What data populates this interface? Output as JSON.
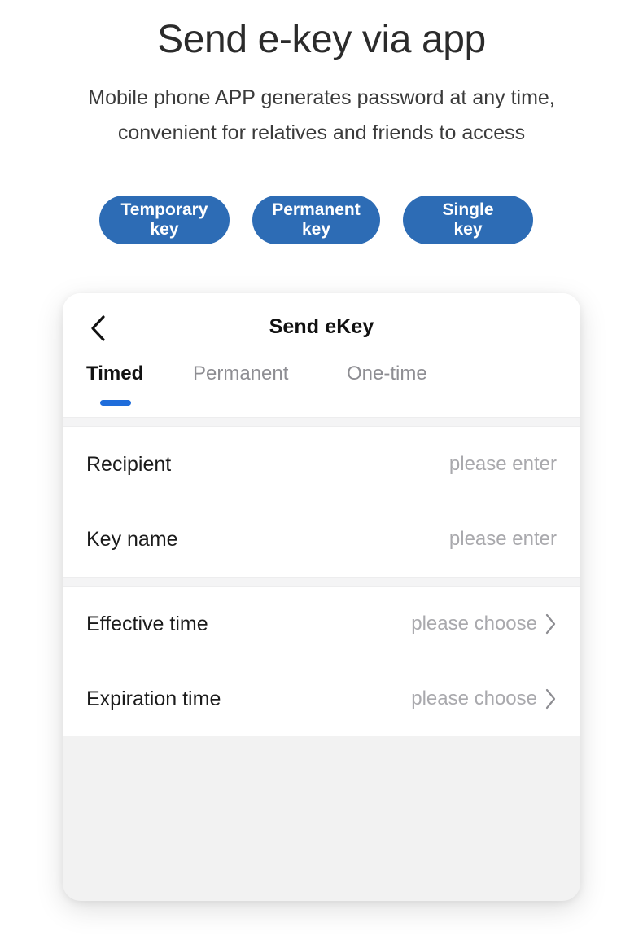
{
  "promo": {
    "title": "Send e-key via app",
    "subtitle_line1": "Mobile phone APP generates password at any time,",
    "subtitle_line2": "convenient for relatives and friends to access",
    "accent_color": "#2d6cb5",
    "buttons": [
      {
        "line1": "Temporary",
        "line2": "key"
      },
      {
        "line1": "Permanent",
        "line2": "key"
      },
      {
        "line1": "Single",
        "line2": "key"
      }
    ]
  },
  "phone": {
    "nav": {
      "title": "Send eKey",
      "back_icon": "chevron-left-icon"
    },
    "tabs": [
      {
        "label": "Timed",
        "active": true
      },
      {
        "label": "Permanent",
        "active": false
      },
      {
        "label": "One-time",
        "active": false
      }
    ],
    "tab_indicator_color": "#1f6ddb",
    "groups": [
      {
        "rows": [
          {
            "label": "Recipient",
            "value": "please enter",
            "chevron": false
          },
          {
            "label": "Key name",
            "value": "please enter",
            "chevron": false
          }
        ]
      },
      {
        "rows": [
          {
            "label": "Effective time",
            "value": "please choose",
            "chevron": true,
            "chevron_icon": "chevron-right-icon"
          },
          {
            "label": "Expiration time",
            "value": "please choose",
            "chevron": true,
            "chevron_icon": "chevron-right-icon"
          }
        ]
      }
    ]
  }
}
